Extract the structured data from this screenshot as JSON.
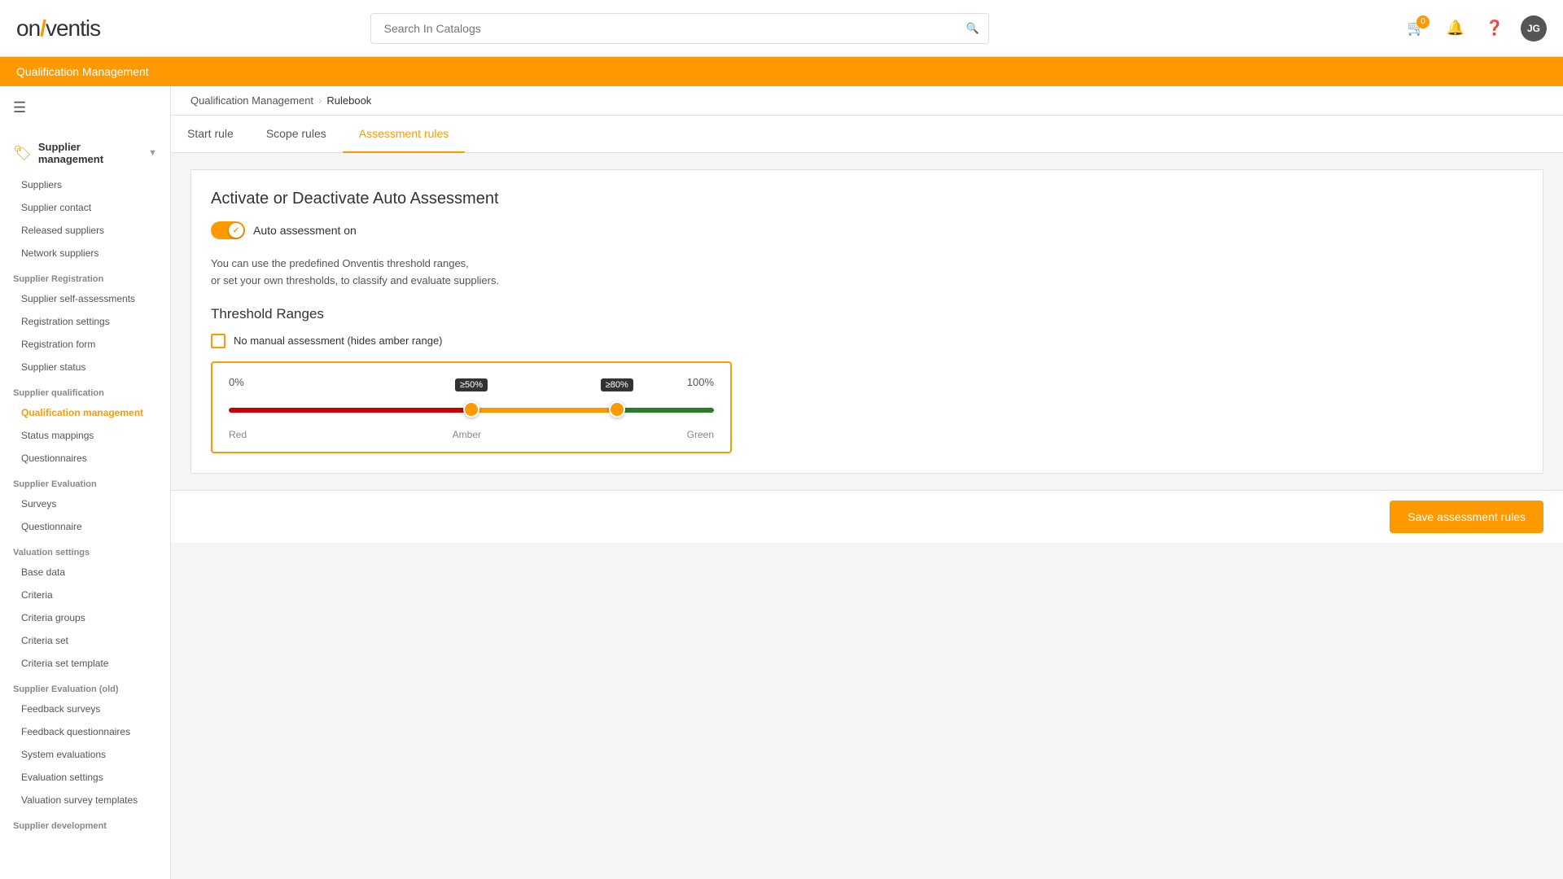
{
  "header": {
    "logo_v": "on",
    "logo_slash": "/",
    "logo_entis": "ventis",
    "search_placeholder": "Search In Catalogs",
    "cart_count": "0",
    "avatar_initials": "JG"
  },
  "qual_bar": {
    "title": "Qualification Management"
  },
  "breadcrumb": {
    "parent": "Qualification Management",
    "current": "Rulebook"
  },
  "sidebar": {
    "section_header": "Supplier management",
    "items_supplier": [
      {
        "label": "Suppliers",
        "active": false
      },
      {
        "label": "Supplier contact",
        "active": false
      },
      {
        "label": "Released suppliers",
        "active": false
      },
      {
        "label": "Network suppliers",
        "active": false
      }
    ],
    "section_registration": "Supplier Registration",
    "items_registration": [
      {
        "label": "Supplier self-assessments",
        "active": false
      },
      {
        "label": "Registration settings",
        "active": false
      },
      {
        "label": "Registration form",
        "active": false
      },
      {
        "label": "Supplier status",
        "active": false
      }
    ],
    "section_qualification": "Supplier qualification",
    "items_qualification": [
      {
        "label": "Qualification management",
        "active": true
      },
      {
        "label": "Status mappings",
        "active": false
      },
      {
        "label": "Questionnaires",
        "active": false
      }
    ],
    "section_evaluation": "Supplier Evaluation",
    "items_evaluation": [
      {
        "label": "Surveys",
        "active": false
      },
      {
        "label": "Questionnaire",
        "active": false
      }
    ],
    "section_valuation": "Valuation settings",
    "items_valuation": [
      {
        "label": "Base data",
        "active": false
      },
      {
        "label": "Criteria",
        "active": false
      },
      {
        "label": "Criteria groups",
        "active": false
      },
      {
        "label": "Criteria set",
        "active": false
      },
      {
        "label": "Criteria set template",
        "active": false
      }
    ],
    "section_evaluation_old": "Supplier Evaluation (old)",
    "items_evaluation_old": [
      {
        "label": "Feedback surveys",
        "active": false
      },
      {
        "label": "Feedback questionnaires",
        "active": false
      },
      {
        "label": "System evaluations",
        "active": false
      },
      {
        "label": "Evaluation settings",
        "active": false
      },
      {
        "label": "Valuation survey templates",
        "active": false
      }
    ],
    "section_development": "Supplier development"
  },
  "tabs": [
    {
      "label": "Start rule",
      "active": false
    },
    {
      "label": "Scope rules",
      "active": false
    },
    {
      "label": "Assessment rules",
      "active": true
    }
  ],
  "content": {
    "heading": "Activate or Deactivate Auto Assessment",
    "toggle_label": "Auto assessment on",
    "info_line1": "You can use the predefined Onventis threshold ranges,",
    "info_line2": "or set your own thresholds, to classify and evaluate suppliers.",
    "threshold_heading": "Threshold Ranges",
    "no_manual_label": "No manual assessment (hides amber range)",
    "slider": {
      "min_label": "0%",
      "max_label": "100%",
      "thumb1_label": "≥50%",
      "thumb1_pct": 50,
      "thumb2_label": "≥80%",
      "thumb2_pct": 80,
      "label_red": "Red",
      "label_amber": "Amber",
      "label_green": "Green"
    }
  },
  "footer": {
    "save_label": "Save assessment rules"
  }
}
